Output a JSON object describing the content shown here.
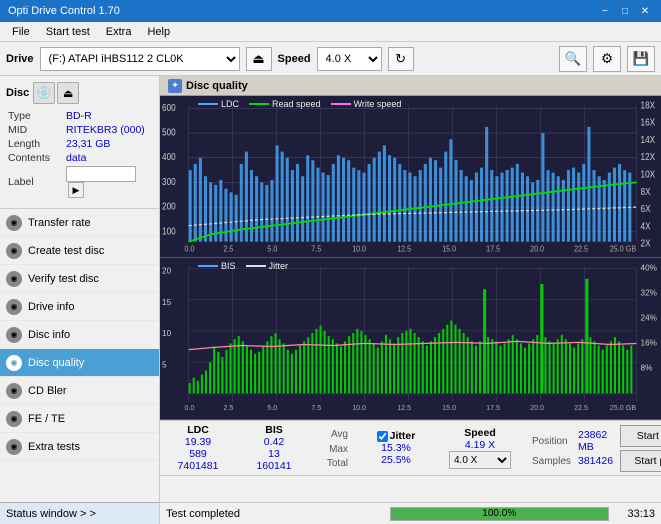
{
  "app": {
    "title": "Opti Drive Control 1.70",
    "minimize_label": "−",
    "maximize_label": "□",
    "close_label": "✕"
  },
  "menu": {
    "items": [
      "File",
      "Start test",
      "Extra",
      "Help"
    ]
  },
  "toolbar": {
    "drive_label": "Drive",
    "drive_value": "(F:)  ATAPI iHBS112  2 CL0K",
    "speed_label": "Speed",
    "speed_value": "4.0 X"
  },
  "disc": {
    "header": "Disc",
    "type_label": "Type",
    "type_value": "BD-R",
    "mid_label": "MID",
    "mid_value": "RITEKBR3 (000)",
    "length_label": "Length",
    "length_value": "23,31 GB",
    "contents_label": "Contents",
    "contents_value": "data",
    "label_label": "Label",
    "label_placeholder": ""
  },
  "nav": {
    "items": [
      {
        "id": "transfer-rate",
        "label": "Transfer rate",
        "active": false
      },
      {
        "id": "create-test-disc",
        "label": "Create test disc",
        "active": false
      },
      {
        "id": "verify-test-disc",
        "label": "Verify test disc",
        "active": false
      },
      {
        "id": "drive-info",
        "label": "Drive info",
        "active": false
      },
      {
        "id": "disc-info",
        "label": "Disc info",
        "active": false
      },
      {
        "id": "disc-quality",
        "label": "Disc quality",
        "active": true
      },
      {
        "id": "cd-bler",
        "label": "CD Bler",
        "active": false
      },
      {
        "id": "fe-te",
        "label": "FE / TE",
        "active": false
      },
      {
        "id": "extra-tests",
        "label": "Extra tests",
        "active": false
      }
    ]
  },
  "status_window": {
    "label": "Status window  > >"
  },
  "chart": {
    "title": "Disc quality",
    "legend_upper": [
      {
        "label": "LDC",
        "color": "#00aaff"
      },
      {
        "label": "Read speed",
        "color": "#00ff00"
      },
      {
        "label": "Write speed",
        "color": "#ff66ff"
      }
    ],
    "legend_lower": [
      {
        "label": "BIS",
        "color": "#00aaff"
      },
      {
        "label": "Jitter",
        "color": "#ffffff"
      }
    ],
    "upper_y_left_max": "600",
    "upper_y_right_labels": [
      "18X",
      "16X",
      "14X",
      "12X",
      "10X",
      "8X",
      "6X",
      "4X",
      "2X"
    ],
    "lower_y_left_max": "20",
    "lower_y_right_labels": [
      "40%",
      "32%",
      "24%",
      "16%",
      "8%"
    ],
    "x_labels": [
      "0.0",
      "2.5",
      "5.0",
      "7.5",
      "10.0",
      "12.5",
      "15.0",
      "17.5",
      "20.0",
      "22.5",
      "25.0 GB"
    ]
  },
  "stats": {
    "ldc_header": "LDC",
    "bis_header": "BIS",
    "jitter_header": "Jitter",
    "speed_header": "Speed",
    "avg_label": "Avg",
    "max_label": "Max",
    "total_label": "Total",
    "ldc_avg": "19.39",
    "ldc_max": "589",
    "ldc_total": "7401481",
    "bis_avg": "0.42",
    "bis_max": "13",
    "bis_total": "160141",
    "jitter_avg": "15.3%",
    "jitter_max": "25.5%",
    "speed_val": "4.19 X",
    "speed_select": "4.0 X",
    "position_label": "Position",
    "position_value": "23862 MB",
    "samples_label": "Samples",
    "samples_value": "381426",
    "start_full_label": "Start full",
    "start_part_label": "Start part",
    "jitter_checked": true,
    "jitter_checkbox_label": "Jitter"
  },
  "statusbar": {
    "text": "Test completed",
    "progress": 100,
    "progress_text": "100.0%",
    "time": "33:13"
  },
  "colors": {
    "active_nav_bg": "#4a9fd4",
    "chart_bg": "#1e1e3a",
    "grid_line": "#444466",
    "ldc_color": "#44aaff",
    "read_speed_color": "#00dd00",
    "write_speed_color": "#ff66ff",
    "bis_color": "#44aaff",
    "jitter_color": "#dddddd",
    "progress_fill": "#4caf50"
  }
}
